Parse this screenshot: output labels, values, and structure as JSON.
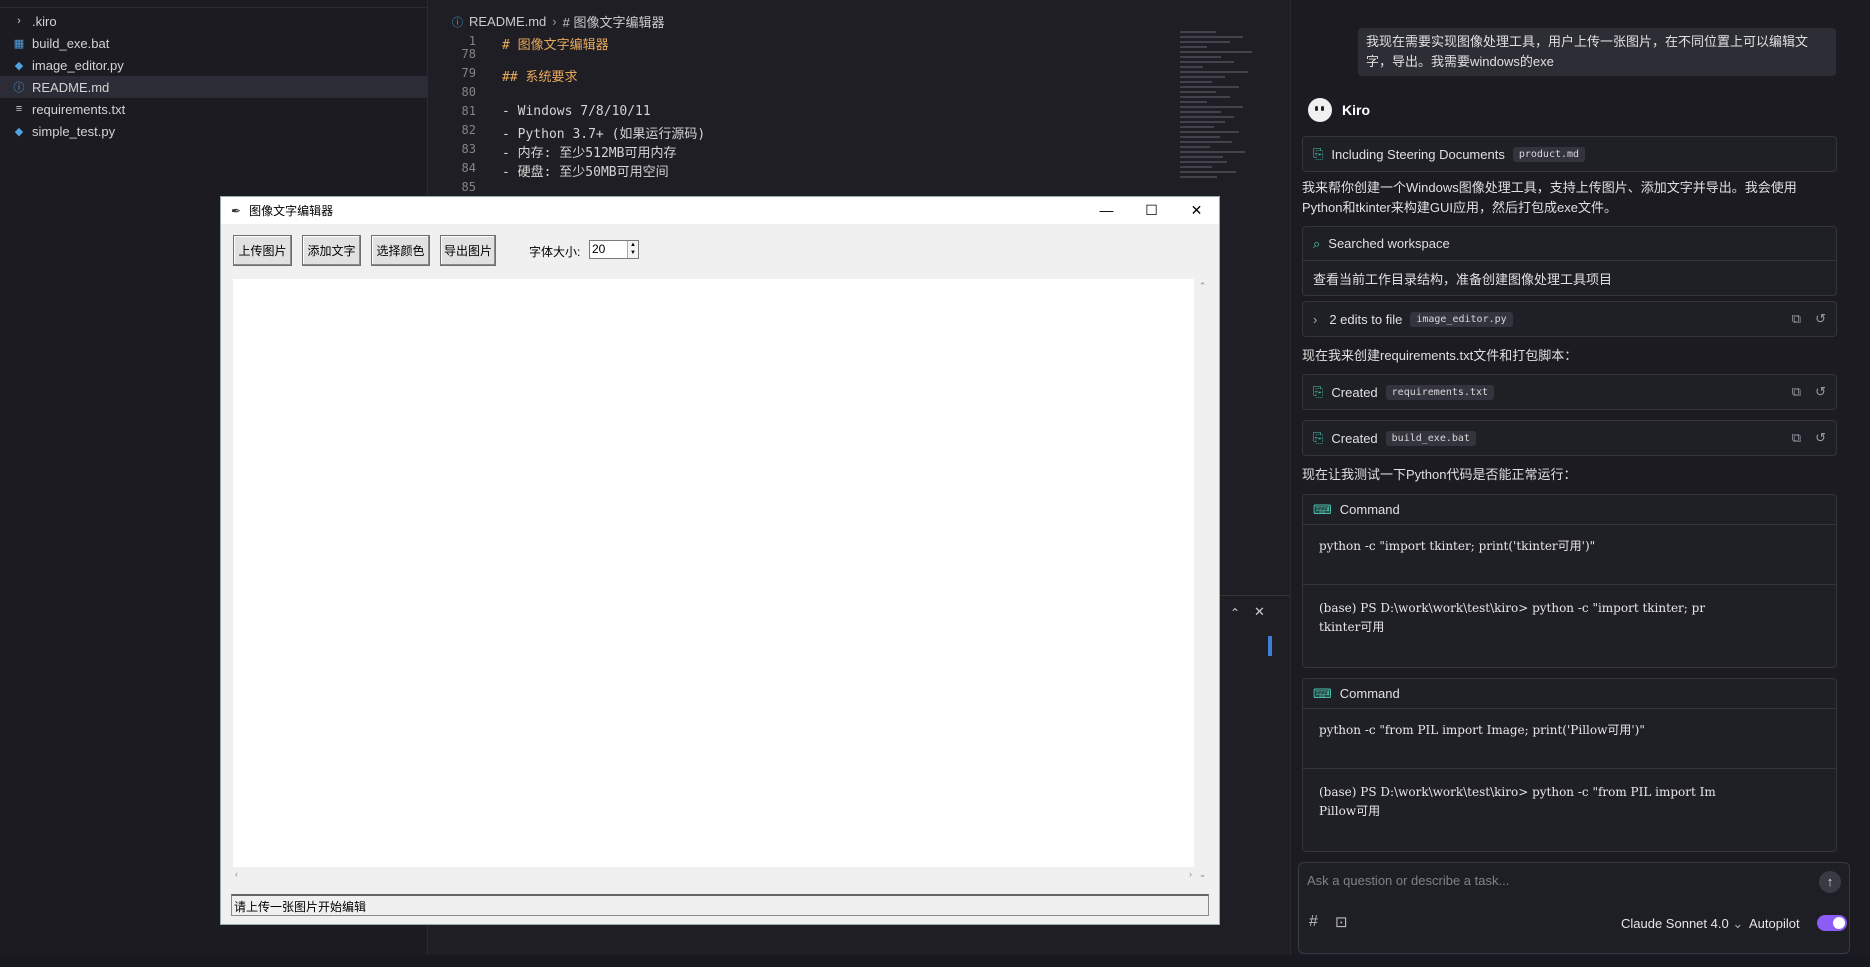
{
  "explorer": {
    "items": [
      {
        "label": ".kiro",
        "icon": "chevron-right-icon",
        "glyph": "›",
        "color": "#cccccc"
      },
      {
        "label": "build_exe.bat",
        "icon": "windows-icon",
        "glyph": "▦",
        "color": "#4fa3e0"
      },
      {
        "label": "image_editor.py",
        "icon": "python-icon",
        "glyph": "◆",
        "color": "#4fa3e0"
      },
      {
        "label": "README.md",
        "icon": "info-icon",
        "glyph": "ⓘ",
        "color": "#4fa3e0"
      },
      {
        "label": "requirements.txt",
        "icon": "lines-icon",
        "glyph": "≡",
        "color": "#cccccc"
      },
      {
        "label": "simple_test.py",
        "icon": "python-icon",
        "glyph": "◆",
        "color": "#4fa3e0"
      }
    ]
  },
  "editor": {
    "breadcrumb_file": "README.md",
    "breadcrumb_section": "# 图像文字编辑器",
    "lines": [
      {
        "num": "1",
        "text": "# 图像文字编辑器"
      },
      {
        "num": "78",
        "text": ""
      },
      {
        "num": "79",
        "text": "## 系统要求"
      },
      {
        "num": "80",
        "text": ""
      },
      {
        "num": "81",
        "text": "- Windows 7/8/10/11"
      },
      {
        "num": "82",
        "text": "- Python 3.7+ (如果运行源码)"
      },
      {
        "num": "83",
        "text": "- 内存: 至少512MB可用内存"
      },
      {
        "num": "84",
        "text": "- 硬盘: 至少50MB可用空间"
      },
      {
        "num": "85",
        "text": ""
      }
    ]
  },
  "tkwindow": {
    "title": "图像文字编辑器",
    "buttons": {
      "upload": "上传图片",
      "add_text": "添加文字",
      "color": "选择颜色",
      "export": "导出图片"
    },
    "font_size_label": "字体大小:",
    "font_size_value": "20",
    "status": "请上传一张图片开始编辑"
  },
  "chat": {
    "user_message": "我现在需要实现图像处理工具，用户上传一张图片，在不同位置上可以编辑文字，导出。我需要windows的exe",
    "agent_name": "Kiro",
    "steering": {
      "label": "Including Steering Documents",
      "chip": "product.md"
    },
    "intro": "我来帮你创建一个Windows图像处理工具，支持上传图片、添加文字并导出。我会使用Python和tkinter来构建GUI应用，然后打包成exe文件。",
    "search": {
      "label": "Searched workspace",
      "detail": "查看当前工作目录结构，准备创建图像处理工具项目"
    },
    "edits": {
      "label": "2 edits to file",
      "chip": "image_editor.py"
    },
    "para2": "现在我来创建requirements.txt文件和打包脚本：",
    "created1": {
      "label": "Created",
      "chip": "requirements.txt"
    },
    "created2": {
      "label": "Created",
      "chip": "build_exe.bat"
    },
    "para3": "现在让我测试一下Python代码是否能正常运行：",
    "cmd1": {
      "header": "Command",
      "command": "python -c \"import tkinter; print('tkinter可用')\"",
      "output": "(base) PS D:\\work\\work\\test\\kiro> python -c \"import tkinter; pr\ntkinter可用"
    },
    "cmd2": {
      "header": "Command",
      "command": "python -c \"from PIL import Image; print('Pillow可用')\"",
      "output": "(base) PS D:\\work\\work\\test\\kiro> python -c \"from PIL import Im\nPillow可用"
    },
    "input_placeholder": "Ask a question or describe a task...",
    "model": "Claude Sonnet 4.0",
    "autopilot_label": "Autopilot",
    "accent": "#8b5cf6"
  }
}
